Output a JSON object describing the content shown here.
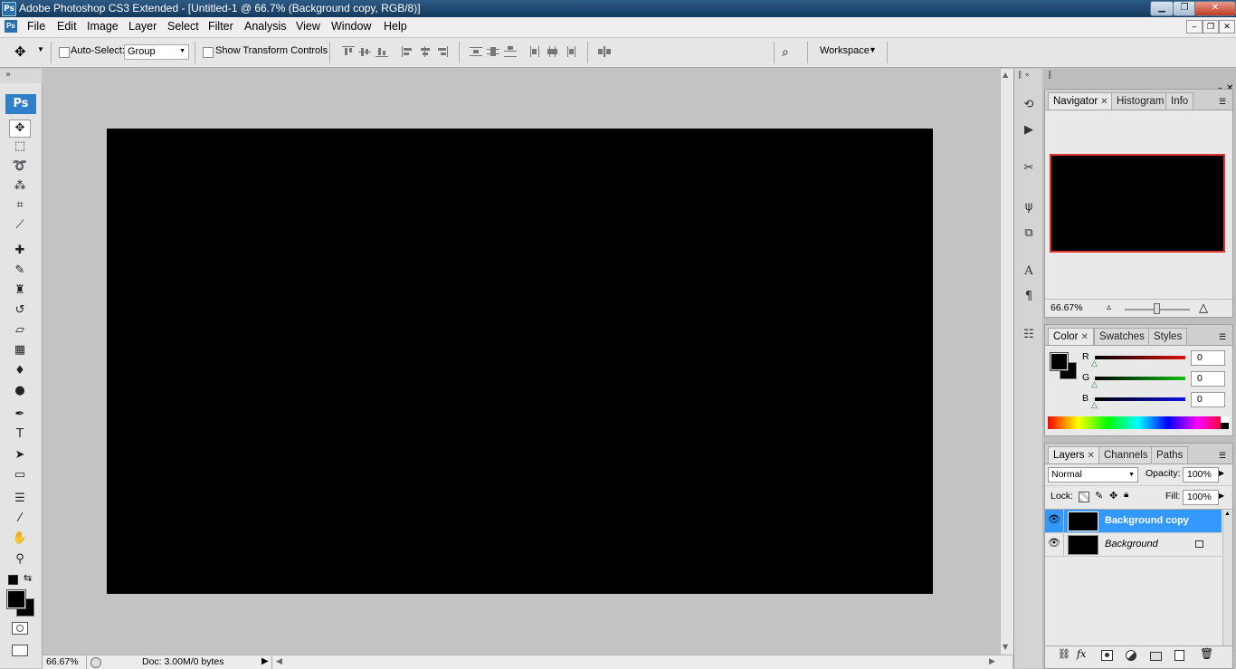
{
  "window": {
    "app_icon": "Ps",
    "title": "Adobe Photoshop CS3 Extended - [Untitled-1 @ 66.7% (Background copy, RGB/8)]",
    "min": "▁",
    "max": "❐",
    "close": "✕"
  },
  "menu": {
    "items": [
      "File",
      "Edit",
      "Image",
      "Layer",
      "Select",
      "Filter",
      "Analysis",
      "View",
      "Window",
      "Help"
    ],
    "doc_controls": [
      "–",
      "❐",
      "✕"
    ]
  },
  "options": {
    "auto_select_label": "Auto-Select:",
    "auto_select_value": "Group",
    "show_transform_label": "Show Transform Controls",
    "workspace_label": "Workspace"
  },
  "toolbar": {
    "logo": "Ps",
    "tools": [
      {
        "name": "move-tool",
        "glyph": "✥"
      },
      {
        "name": "marquee-tool",
        "glyph": "⬚"
      },
      {
        "name": "lasso-tool",
        "glyph": "➰"
      },
      {
        "name": "magic-wand-tool",
        "glyph": "⁂"
      },
      {
        "name": "crop-tool",
        "glyph": "⌗"
      },
      {
        "name": "slice-tool",
        "glyph": "⟋"
      },
      {
        "name": "healing-brush-tool",
        "glyph": "✚"
      },
      {
        "name": "brush-tool",
        "glyph": "✎"
      },
      {
        "name": "clone-stamp-tool",
        "glyph": "♜"
      },
      {
        "name": "history-brush-tool",
        "glyph": "↺"
      },
      {
        "name": "eraser-tool",
        "glyph": "▱"
      },
      {
        "name": "gradient-tool",
        "glyph": "▦"
      },
      {
        "name": "blur-tool",
        "glyph": "♦"
      },
      {
        "name": "dodge-tool",
        "glyph": "●"
      },
      {
        "name": "pen-tool",
        "glyph": "✒"
      },
      {
        "name": "type-tool",
        "glyph": "T"
      },
      {
        "name": "path-selection-tool",
        "glyph": "➤"
      },
      {
        "name": "shape-tool",
        "glyph": "▭"
      },
      {
        "name": "notes-tool",
        "glyph": "☰"
      },
      {
        "name": "eyedropper-tool",
        "glyph": "⁄"
      },
      {
        "name": "hand-tool",
        "glyph": "✋"
      },
      {
        "name": "zoom-tool",
        "glyph": "⚲"
      }
    ]
  },
  "status": {
    "zoom": "66.67%",
    "doc": "Doc: 3.00M/0 bytes"
  },
  "navigator": {
    "tabs": [
      "Navigator",
      "Histogram",
      "Info"
    ],
    "zoom": "66.67%"
  },
  "color_panel": {
    "tabs": [
      "Color",
      "Swatches",
      "Styles"
    ],
    "channels": [
      {
        "label": "R",
        "value": "0",
        "color": "#e01010"
      },
      {
        "label": "G",
        "value": "0",
        "color": "#10c010"
      },
      {
        "label": "B",
        "value": "0",
        "color": "#1010e0"
      }
    ]
  },
  "layers_panel": {
    "tabs": [
      "Layers",
      "Channels",
      "Paths"
    ],
    "blend_mode": "Normal",
    "opacity_label": "Opacity:",
    "opacity": "100%",
    "lock_label": "Lock:",
    "fill_label": "Fill:",
    "fill": "100%",
    "layers": [
      {
        "name": "Background copy",
        "selected": true,
        "locked": false
      },
      {
        "name": "Background",
        "selected": false,
        "locked": true
      }
    ]
  },
  "colors": {
    "selection": "#3399ff",
    "navigator_frame": "#e03030"
  }
}
